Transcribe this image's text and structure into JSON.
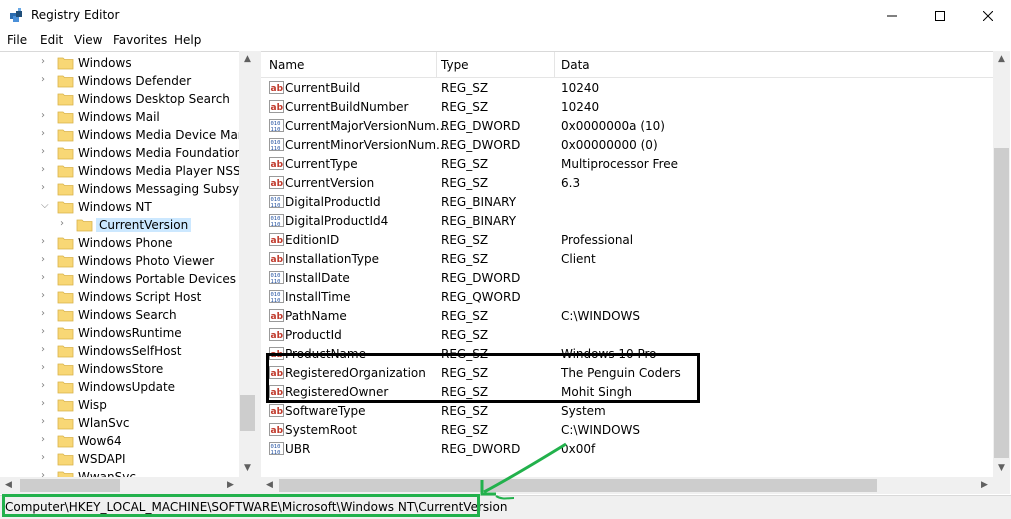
{
  "window": {
    "title": "Registry Editor"
  },
  "menu": [
    "File",
    "Edit",
    "View",
    "Favorites",
    "Help"
  ],
  "tree": {
    "items": [
      {
        "label": "Windows",
        "expander": "collapsed"
      },
      {
        "label": "Windows Defender",
        "expander": "collapsed"
      },
      {
        "label": "Windows Desktop Search",
        "expander": "none"
      },
      {
        "label": "Windows Mail",
        "expander": "collapsed"
      },
      {
        "label": "Windows Media Device Manag",
        "expander": "collapsed"
      },
      {
        "label": "Windows Media Foundation",
        "expander": "collapsed"
      },
      {
        "label": "Windows Media Player NSS",
        "expander": "collapsed"
      },
      {
        "label": "Windows Messaging Subsyste",
        "expander": "collapsed"
      },
      {
        "label": "Windows NT",
        "expander": "expanded"
      },
      {
        "label": "CurrentVersion",
        "expander": "collapsed",
        "selected": true,
        "child": true
      },
      {
        "label": "Windows Phone",
        "expander": "collapsed"
      },
      {
        "label": "Windows Photo Viewer",
        "expander": "collapsed"
      },
      {
        "label": "Windows Portable Devices",
        "expander": "collapsed"
      },
      {
        "label": "Windows Script Host",
        "expander": "collapsed"
      },
      {
        "label": "Windows Search",
        "expander": "collapsed"
      },
      {
        "label": "WindowsRuntime",
        "expander": "collapsed"
      },
      {
        "label": "WindowsSelfHost",
        "expander": "collapsed"
      },
      {
        "label": "WindowsStore",
        "expander": "collapsed"
      },
      {
        "label": "WindowsUpdate",
        "expander": "collapsed"
      },
      {
        "label": "Wisp",
        "expander": "collapsed"
      },
      {
        "label": "WlanSvc",
        "expander": "collapsed"
      },
      {
        "label": "Wow64",
        "expander": "collapsed"
      },
      {
        "label": "WSDAPI",
        "expander": "collapsed"
      },
      {
        "label": "WwanSvc",
        "expander": "collapsed"
      }
    ]
  },
  "list": {
    "columns": [
      "Name",
      "Type",
      "Data"
    ],
    "rows": [
      {
        "icon": "string",
        "name": "CurrentBuild",
        "type": "REG_SZ",
        "data": "10240"
      },
      {
        "icon": "string",
        "name": "CurrentBuildNumber",
        "type": "REG_SZ",
        "data": "10240"
      },
      {
        "icon": "binary",
        "name": "CurrentMajorVersionNum...",
        "type": "REG_DWORD",
        "data": "0x0000000a (10)"
      },
      {
        "icon": "binary",
        "name": "CurrentMinorVersionNum...",
        "type": "REG_DWORD",
        "data": "0x00000000 (0)"
      },
      {
        "icon": "string",
        "name": "CurrentType",
        "type": "REG_SZ",
        "data": "Multiprocessor Free"
      },
      {
        "icon": "string",
        "name": "CurrentVersion",
        "type": "REG_SZ",
        "data": "6.3"
      },
      {
        "icon": "binary",
        "name": "DigitalProductId",
        "type": "REG_BINARY",
        "data": ""
      },
      {
        "icon": "binary",
        "name": "DigitalProductId4",
        "type": "REG_BINARY",
        "data": ""
      },
      {
        "icon": "string",
        "name": "EditionID",
        "type": "REG_SZ",
        "data": "Professional"
      },
      {
        "icon": "string",
        "name": "InstallationType",
        "type": "REG_SZ",
        "data": "Client"
      },
      {
        "icon": "binary",
        "name": "InstallDate",
        "type": "REG_DWORD",
        "data": ""
      },
      {
        "icon": "binary",
        "name": "InstallTime",
        "type": "REG_QWORD",
        "data": ""
      },
      {
        "icon": "string",
        "name": "PathName",
        "type": "REG_SZ",
        "data": "C:\\WINDOWS"
      },
      {
        "icon": "string",
        "name": "ProductId",
        "type": "REG_SZ",
        "data": ""
      },
      {
        "icon": "string",
        "name": "ProductName",
        "type": "REG_SZ",
        "data": "Windows 10 Pro"
      },
      {
        "icon": "string",
        "name": "RegisteredOrganization",
        "type": "REG_SZ",
        "data": "The Penguin Coders"
      },
      {
        "icon": "string",
        "name": "RegisteredOwner",
        "type": "REG_SZ",
        "data": "Mohit Singh"
      },
      {
        "icon": "string",
        "name": "SoftwareType",
        "type": "REG_SZ",
        "data": "System"
      },
      {
        "icon": "string",
        "name": "SystemRoot",
        "type": "REG_SZ",
        "data": "C:\\WINDOWS"
      },
      {
        "icon": "binary",
        "name": "UBR",
        "type": "REG_DWORD",
        "data": "0x00f"
      }
    ]
  },
  "status": {
    "path": "Computer\\HKEY_LOCAL_MACHINE\\SOFTWARE\\Microsoft\\Windows NT\\CurrentVersion"
  },
  "colors": {
    "selection": "#cce8ff",
    "annotation_box": "#000000",
    "annotation_green": "#22b14c",
    "folder": "#f8d775"
  },
  "icons": {
    "app": "registry-editor-icon",
    "string_value": "ab-string-icon",
    "binary_value": "binary-value-icon",
    "folder": "folder-icon"
  }
}
